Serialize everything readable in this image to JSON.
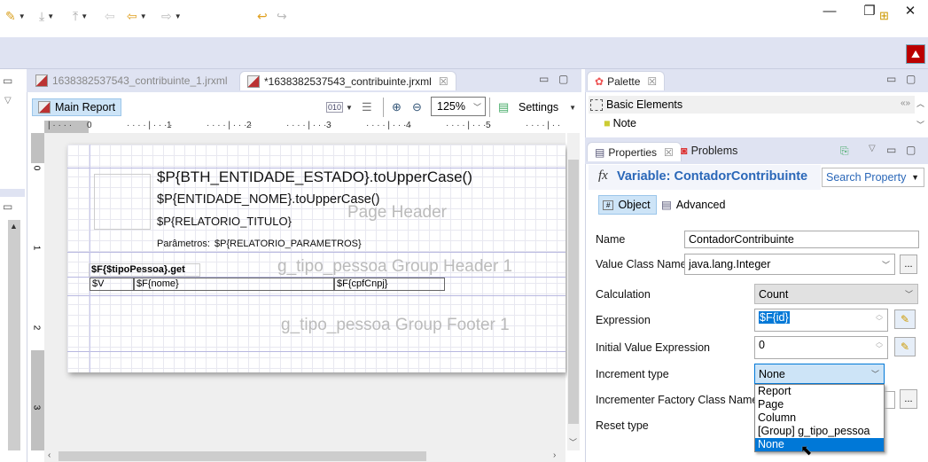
{
  "window": {
    "minimize": "—",
    "restore": "❐",
    "close": "✕"
  },
  "toolbar": {
    "icons": [
      "brush-icon",
      "step-into-icon",
      "step-out-icon",
      "back-history-icon",
      "back-icon",
      "forward-icon",
      "undo-icon",
      "redo-icon",
      "open-perspective-icon",
      "jaspersoft-perspective-icon"
    ]
  },
  "editor": {
    "tabs": [
      {
        "label": "1638382537543_contribuinte_1.jrxml",
        "active": false
      },
      {
        "label": "*1638382537543_contribuinte.jrxml",
        "active": true,
        "close": "☒"
      }
    ],
    "main_report_label": "Main Report",
    "zoom_value": "125%",
    "settings_label": "Settings",
    "ruler_labels": [
      "0",
      "1",
      "2",
      "3",
      "4",
      "5"
    ],
    "vruler_labels": [
      "0",
      "1",
      "2",
      "3"
    ]
  },
  "report": {
    "page_header_label": "Page Header",
    "group_header_label": "g_tipo_pessoa Group Header 1",
    "group_footer_label": "g_tipo_pessoa Group Footer 1",
    "fields": {
      "estado": "$P{BTH_ENTIDADE_ESTADO}.toUpperCase()",
      "nome": "$P{ENTIDADE_NOME}.toUpperCase()",
      "titulo": "$P{RELATORIO_TITULO}",
      "parametros_label": "Parâmetros:",
      "parametros": "$P{RELATORIO_PARAMETROS}",
      "tipo_pessoa": "$F{$tipoPessoa}.get",
      "col_v": "$V",
      "col_nome": "$F{nome}",
      "col_cpf": "$F{cpfCnpj}"
    }
  },
  "palette": {
    "title": "Palette",
    "section": "Basic Elements",
    "items": [
      "Note"
    ]
  },
  "properties": {
    "tabs": [
      "Properties",
      "Problems"
    ],
    "header": "Variable: ContadorContribuinte",
    "search_placeholder": "Search Property",
    "subtabs": [
      "Object",
      "Advanced"
    ],
    "name_label": "Name",
    "name_value": "ContadorContribuinte",
    "value_class_label": "Value Class Name",
    "value_class_value": "java.lang.Integer",
    "calculation_label": "Calculation",
    "calculation_value": "Count",
    "expression_label": "Expression",
    "expression_value": "$F{id}",
    "initial_label": "Initial Value Expression",
    "initial_value": "0",
    "increment_label": "Increment type",
    "increment_value": "None",
    "incrementer_label": "Incrementer Factory Class Name",
    "reset_label": "Reset type",
    "dots": "...",
    "increment_options": [
      "Report",
      "Page",
      "Column",
      "[Group] g_tipo_pessoa",
      "None"
    ],
    "increment_selected": "None"
  }
}
